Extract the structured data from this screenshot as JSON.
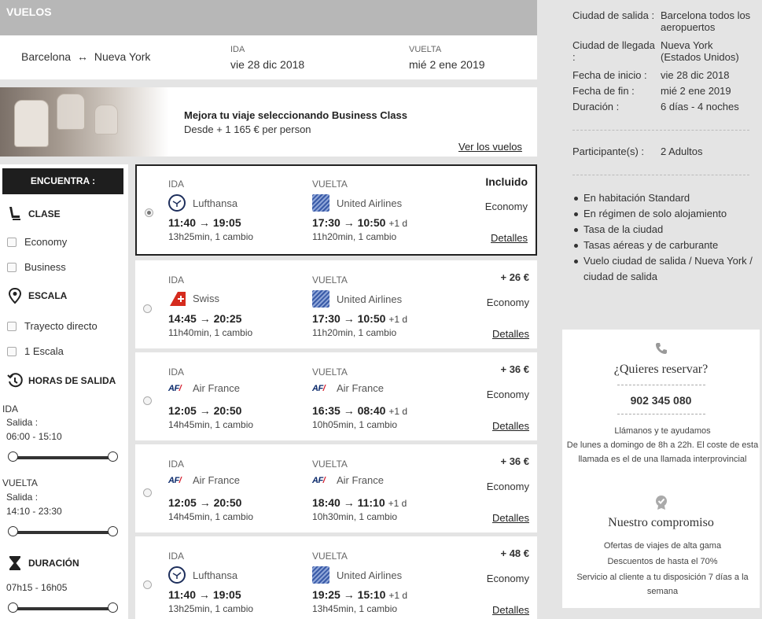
{
  "header": {
    "title": "VUELOS"
  },
  "route": {
    "origin": "Barcelona",
    "destination": "Nueva York",
    "arrows": "↔"
  },
  "outbound": {
    "label": "IDA",
    "date": "vie 28 dic 2018"
  },
  "inbound": {
    "label": "VUELTA",
    "date": "mié 2 ene 2019"
  },
  "promo": {
    "title": "Mejora tu viaje seleccionando Business Class",
    "subtitle": "Desde + 1 165 € per person",
    "link": "Ver los vuelos"
  },
  "filters": {
    "heading": "ENCUENTRA :",
    "class_title": "CLASE",
    "class_options": [
      "Economy",
      "Business"
    ],
    "stops_title": "ESCALA",
    "stops_options": [
      "Trayecto directo",
      "1 Escala"
    ],
    "times_title": "HORAS DE SALIDA",
    "outbound_label": "IDA",
    "outbound_departure_label": "Salida :",
    "outbound_range": "06:00 - 15:10",
    "inbound_label": "VUELTA",
    "inbound_departure_label": "Salida :",
    "inbound_range": "14:10 - 23:30",
    "duration_title": "DURACIÓN",
    "duration_range": "07h15 - 16h05"
  },
  "flights": [
    {
      "selected": true,
      "price": "Incluido",
      "class": "Economy",
      "details": "Detalles",
      "out": {
        "label": "IDA",
        "airline": "Lufthansa",
        "logo": "lufthansa-logo",
        "times": "11:40 → 19:05",
        "plus": "",
        "duration": "13h25min, 1 cambio"
      },
      "ret": {
        "label": "VUELTA",
        "airline": "United Airlines",
        "logo": "united-logo",
        "times": "17:30 → 10:50",
        "plus": "+1 d",
        "duration": "11h20min, 1 cambio"
      }
    },
    {
      "selected": false,
      "price": "+ 26 €",
      "class": "Economy",
      "details": "Detalles",
      "out": {
        "label": "IDA",
        "airline": "Swiss",
        "logo": "swiss-logo",
        "times": "14:45 → 20:25",
        "plus": "",
        "duration": "11h40min, 1 cambio"
      },
      "ret": {
        "label": "VUELTA",
        "airline": "United Airlines",
        "logo": "united-logo",
        "times": "17:30 → 10:50",
        "plus": "+1 d",
        "duration": "11h20min, 1 cambio"
      }
    },
    {
      "selected": false,
      "price": "+ 36 €",
      "class": "Economy",
      "details": "Detalles",
      "out": {
        "label": "IDA",
        "airline": "Air France",
        "logo": "airfrance-logo",
        "times": "12:05 → 20:50",
        "plus": "",
        "duration": "14h45min, 1 cambio"
      },
      "ret": {
        "label": "VUELTA",
        "airline": "Air France",
        "logo": "airfrance-logo",
        "times": "16:35 → 08:40",
        "plus": "+1 d",
        "duration": "10h05min, 1 cambio"
      }
    },
    {
      "selected": false,
      "price": "+ 36 €",
      "class": "Economy",
      "details": "Detalles",
      "out": {
        "label": "IDA",
        "airline": "Air France",
        "logo": "airfrance-logo",
        "times": "12:05 → 20:50",
        "plus": "",
        "duration": "14h45min, 1 cambio"
      },
      "ret": {
        "label": "VUELTA",
        "airline": "Air France",
        "logo": "airfrance-logo",
        "times": "18:40 → 11:10",
        "plus": "+1 d",
        "duration": "10h30min, 1 cambio"
      }
    },
    {
      "selected": false,
      "price": "+ 48 €",
      "class": "Economy",
      "details": "Detalles",
      "out": {
        "label": "IDA",
        "airline": "Lufthansa",
        "logo": "lufthansa-logo",
        "times": "11:40 → 19:05",
        "plus": "",
        "duration": "13h25min, 1 cambio"
      },
      "ret": {
        "label": "VUELTA",
        "airline": "United Airlines",
        "logo": "united-logo",
        "times": "19:25 → 15:10",
        "plus": "+1 d",
        "duration": "13h45min, 1 cambio"
      }
    }
  ],
  "summary": {
    "rows": [
      {
        "key": "Ciudad de salida :",
        "value": "Barcelona todos los aeropuertos"
      },
      {
        "key": "Ciudad de llegada :",
        "value": "Nueva York (Estados Unidos)"
      },
      {
        "key": "Fecha de inicio :",
        "value": "vie 28 dic 2018"
      },
      {
        "key": "Fecha de fin :",
        "value": "mié 2 ene 2019"
      },
      {
        "key": "Duración :",
        "value": "6 días - 4 noches"
      }
    ],
    "participants_key": "Participante(s) :",
    "participants_value": "2 Adultos",
    "included": [
      "En habitación Standard",
      "En régimen de solo alojamiento",
      "Tasa de la ciudad",
      "Tasas aéreas y de carburante",
      "Vuelo ciudad de salida / Nueva York / ciudad de salida"
    ]
  },
  "contact": {
    "title": "¿Quieres reservar?",
    "phone": "902 345 080",
    "call_line": "Llámanos y te ayudamos",
    "hours": "De lunes a domingo de 8h a 22h. El coste de esta llamada es el de una llamada interprovincial",
    "commit_title": "Nuestro compromiso",
    "commit_1": "Ofertas de viajes de alta gama",
    "commit_2": "Descuentos de hasta el 70%",
    "commit_3": "Servicio al cliente a tu disposición 7 días a la semana"
  },
  "colors": {
    "header_gray": "#b7b7b7",
    "dark": "#1e1e1e",
    "bg": "#e4e4e4"
  }
}
